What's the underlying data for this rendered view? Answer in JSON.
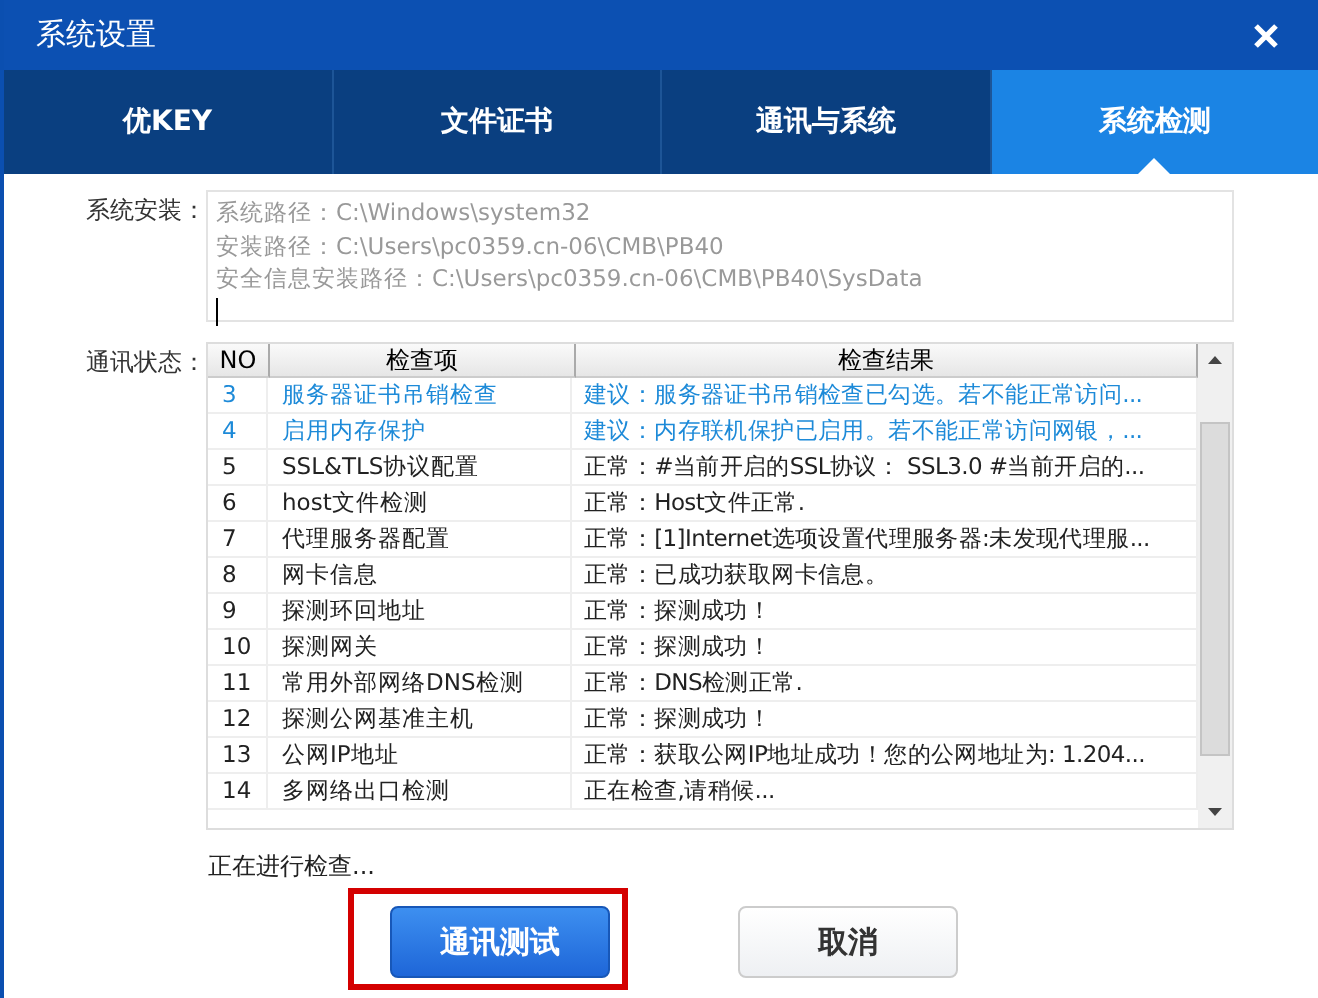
{
  "window": {
    "title": "系统设置"
  },
  "tabs": [
    {
      "label": "优KEY",
      "selected": false
    },
    {
      "label": "文件证书",
      "selected": false
    },
    {
      "label": "通讯与系统",
      "selected": false
    },
    {
      "label": "系统检测",
      "selected": true
    }
  ],
  "install": {
    "label": "系统安装：",
    "lines": [
      "系统路径：C:\\Windows\\system32",
      "安装路径：C:\\Users\\pc0359.cn-06\\CMB\\PB40",
      "安全信息安装路径：C:\\Users\\pc0359.cn-06\\CMB\\PB40\\SysData"
    ]
  },
  "status": {
    "label": "通讯状态：",
    "columns": [
      "NO",
      "检查项",
      "检查结果"
    ],
    "rows": [
      {
        "no": "3",
        "item": "服务器证书吊销检查",
        "result": "建议：服务器证书吊销检查已勾选。若不能正常访问...",
        "kind": "advice"
      },
      {
        "no": "4",
        "item": "启用内存保护",
        "result": "建议：内存联机保护已启用。若不能正常访问网银，...",
        "kind": "advice"
      },
      {
        "no": "5",
        "item": "SSL&TLS协议配置",
        "result": "正常：#当前开启的SSL协议： SSL3.0  #当前开启的...",
        "kind": "normal"
      },
      {
        "no": "6",
        "item": "host文件检测",
        "result": "正常：Host文件正常.",
        "kind": "normal"
      },
      {
        "no": "7",
        "item": "代理服务器配置",
        "result": "正常：[1]Internet选项设置代理服务器:未发现代理服...",
        "kind": "normal"
      },
      {
        "no": "8",
        "item": "网卡信息",
        "result": "正常：已成功获取网卡信息。",
        "kind": "normal"
      },
      {
        "no": "9",
        "item": "探测环回地址",
        "result": "正常：探测成功！",
        "kind": "normal"
      },
      {
        "no": "10",
        "item": "探测网关",
        "result": "正常：探测成功！",
        "kind": "normal"
      },
      {
        "no": "11",
        "item": "常用外部网络DNS检测",
        "result": "正常：DNS检测正常.",
        "kind": "normal"
      },
      {
        "no": "12",
        "item": "探测公网基准主机",
        "result": "正常：探测成功！",
        "kind": "normal"
      },
      {
        "no": "13",
        "item": "公网IP地址",
        "result": "正常：获取公网IP地址成功！您的公网地址为: 1.204...",
        "kind": "normal"
      },
      {
        "no": "14",
        "item": "多网络出口检测",
        "result": " 正在检查,请稍候...",
        "kind": "normal"
      }
    ]
  },
  "progress_text": "正在进行检查...",
  "buttons": [
    {
      "label": "通讯测试",
      "kind": "primary",
      "highlighted": true
    },
    {
      "label": "取消",
      "kind": "secondary",
      "highlighted": false
    }
  ]
}
